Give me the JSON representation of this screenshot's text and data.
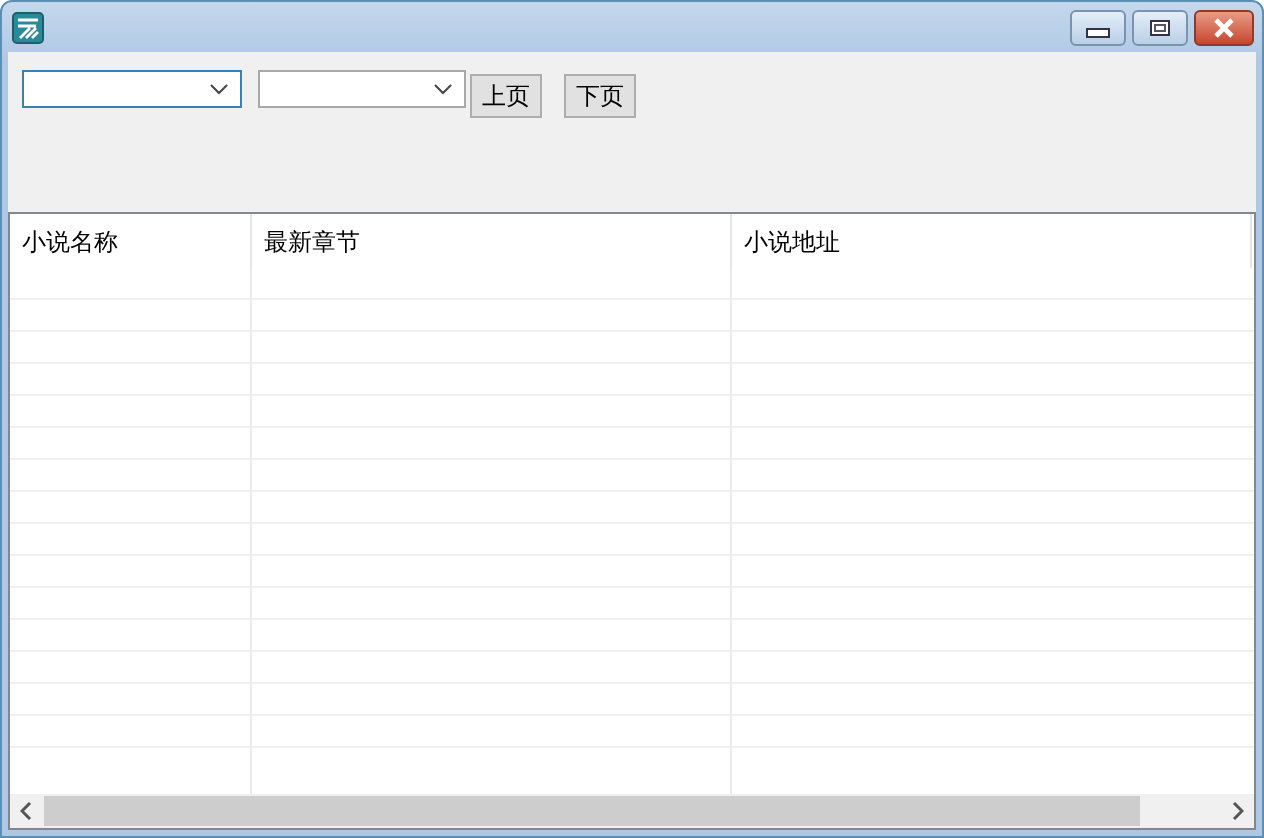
{
  "dropdowns": [
    {
      "focused": true
    },
    {
      "focused": false
    }
  ],
  "buttons": [
    "上页",
    "下页"
  ],
  "table": {
    "columns": [
      "小说名称",
      "最新章节",
      "小说地址"
    ]
  }
}
